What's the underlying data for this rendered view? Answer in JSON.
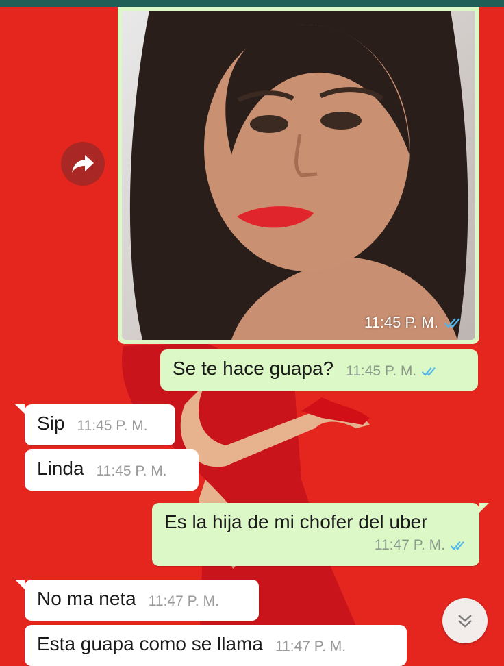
{
  "chat": {
    "image_message": {
      "time": "11:45 P. M.",
      "status": "read"
    },
    "messages": [
      {
        "direction": "outgoing",
        "text": "Se te hace guapa?",
        "time": "11:45 P. M.",
        "status": "read"
      },
      {
        "direction": "incoming",
        "text": "Sip",
        "time": "11:45 P. M."
      },
      {
        "direction": "incoming",
        "text": "Linda",
        "time": "11:45 P. M."
      },
      {
        "direction": "outgoing",
        "text": "Es la hija de mi chofer del uber",
        "time": "11:47 P. M.",
        "status": "read"
      },
      {
        "direction": "incoming",
        "text": "No ma neta",
        "time": "11:47 P. M."
      },
      {
        "direction": "incoming",
        "text": "Esta guapa como se llama",
        "time": "11:47 P. M."
      }
    ]
  },
  "icons": {
    "forward": "forward-arrow-icon",
    "read_receipt": "double-check-icon",
    "scroll_down": "double-chevron-down-icon"
  },
  "colors": {
    "wallpaper": "#e5261f",
    "outgoing_bubble": "#dcf8c6",
    "incoming_bubble": "#ffffff",
    "read_receipt": "#4fb6ec",
    "header": "#1f5f57"
  }
}
